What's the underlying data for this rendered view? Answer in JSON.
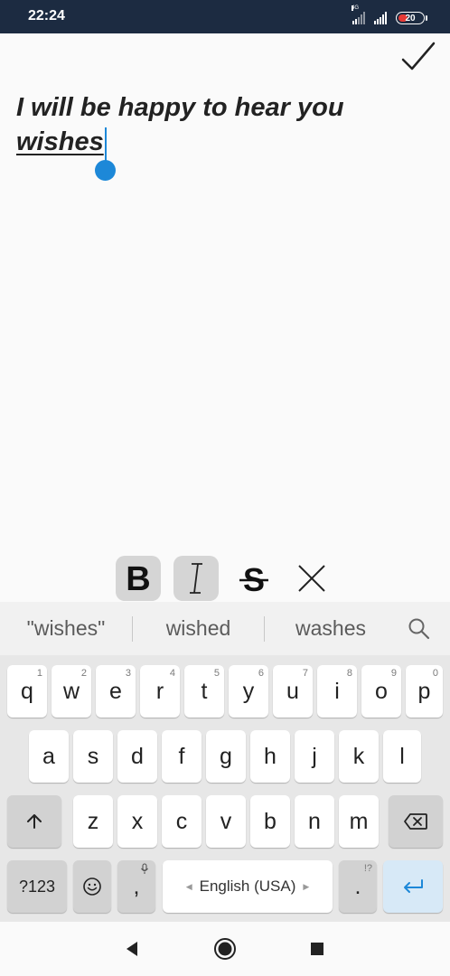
{
  "status_bar": {
    "time": "22:24",
    "network_label": "4G",
    "battery_level": "20"
  },
  "editor": {
    "line1": "I will be happy to hear you",
    "line2": "wishes",
    "confirm_icon": "checkmark-icon"
  },
  "format_toolbar": {
    "bold_icon": "bold-icon",
    "italic_icon": "italic-icon",
    "strikethrough_icon": "strikethrough-icon",
    "clear_icon": "clear-format-icon"
  },
  "keyboard": {
    "suggestions": [
      "\"wishes\"",
      "wished",
      "washes"
    ],
    "row1": [
      {
        "label": "q",
        "hint": "1"
      },
      {
        "label": "w",
        "hint": "2"
      },
      {
        "label": "e",
        "hint": "3"
      },
      {
        "label": "r",
        "hint": "4"
      },
      {
        "label": "t",
        "hint": "5"
      },
      {
        "label": "y",
        "hint": "6"
      },
      {
        "label": "u",
        "hint": "7"
      },
      {
        "label": "i",
        "hint": "8"
      },
      {
        "label": "o",
        "hint": "9"
      },
      {
        "label": "p",
        "hint": "0"
      }
    ],
    "row2": [
      "a",
      "s",
      "d",
      "f",
      "g",
      "h",
      "j",
      "k",
      "l"
    ],
    "row3": [
      "z",
      "x",
      "c",
      "v",
      "b",
      "n",
      "m"
    ],
    "symbols_label": "?123",
    "comma_label": ",",
    "space_label": "English (USA)",
    "period_label": ".",
    "period_hint": "!?",
    "accent_color": "#1d88d8"
  }
}
